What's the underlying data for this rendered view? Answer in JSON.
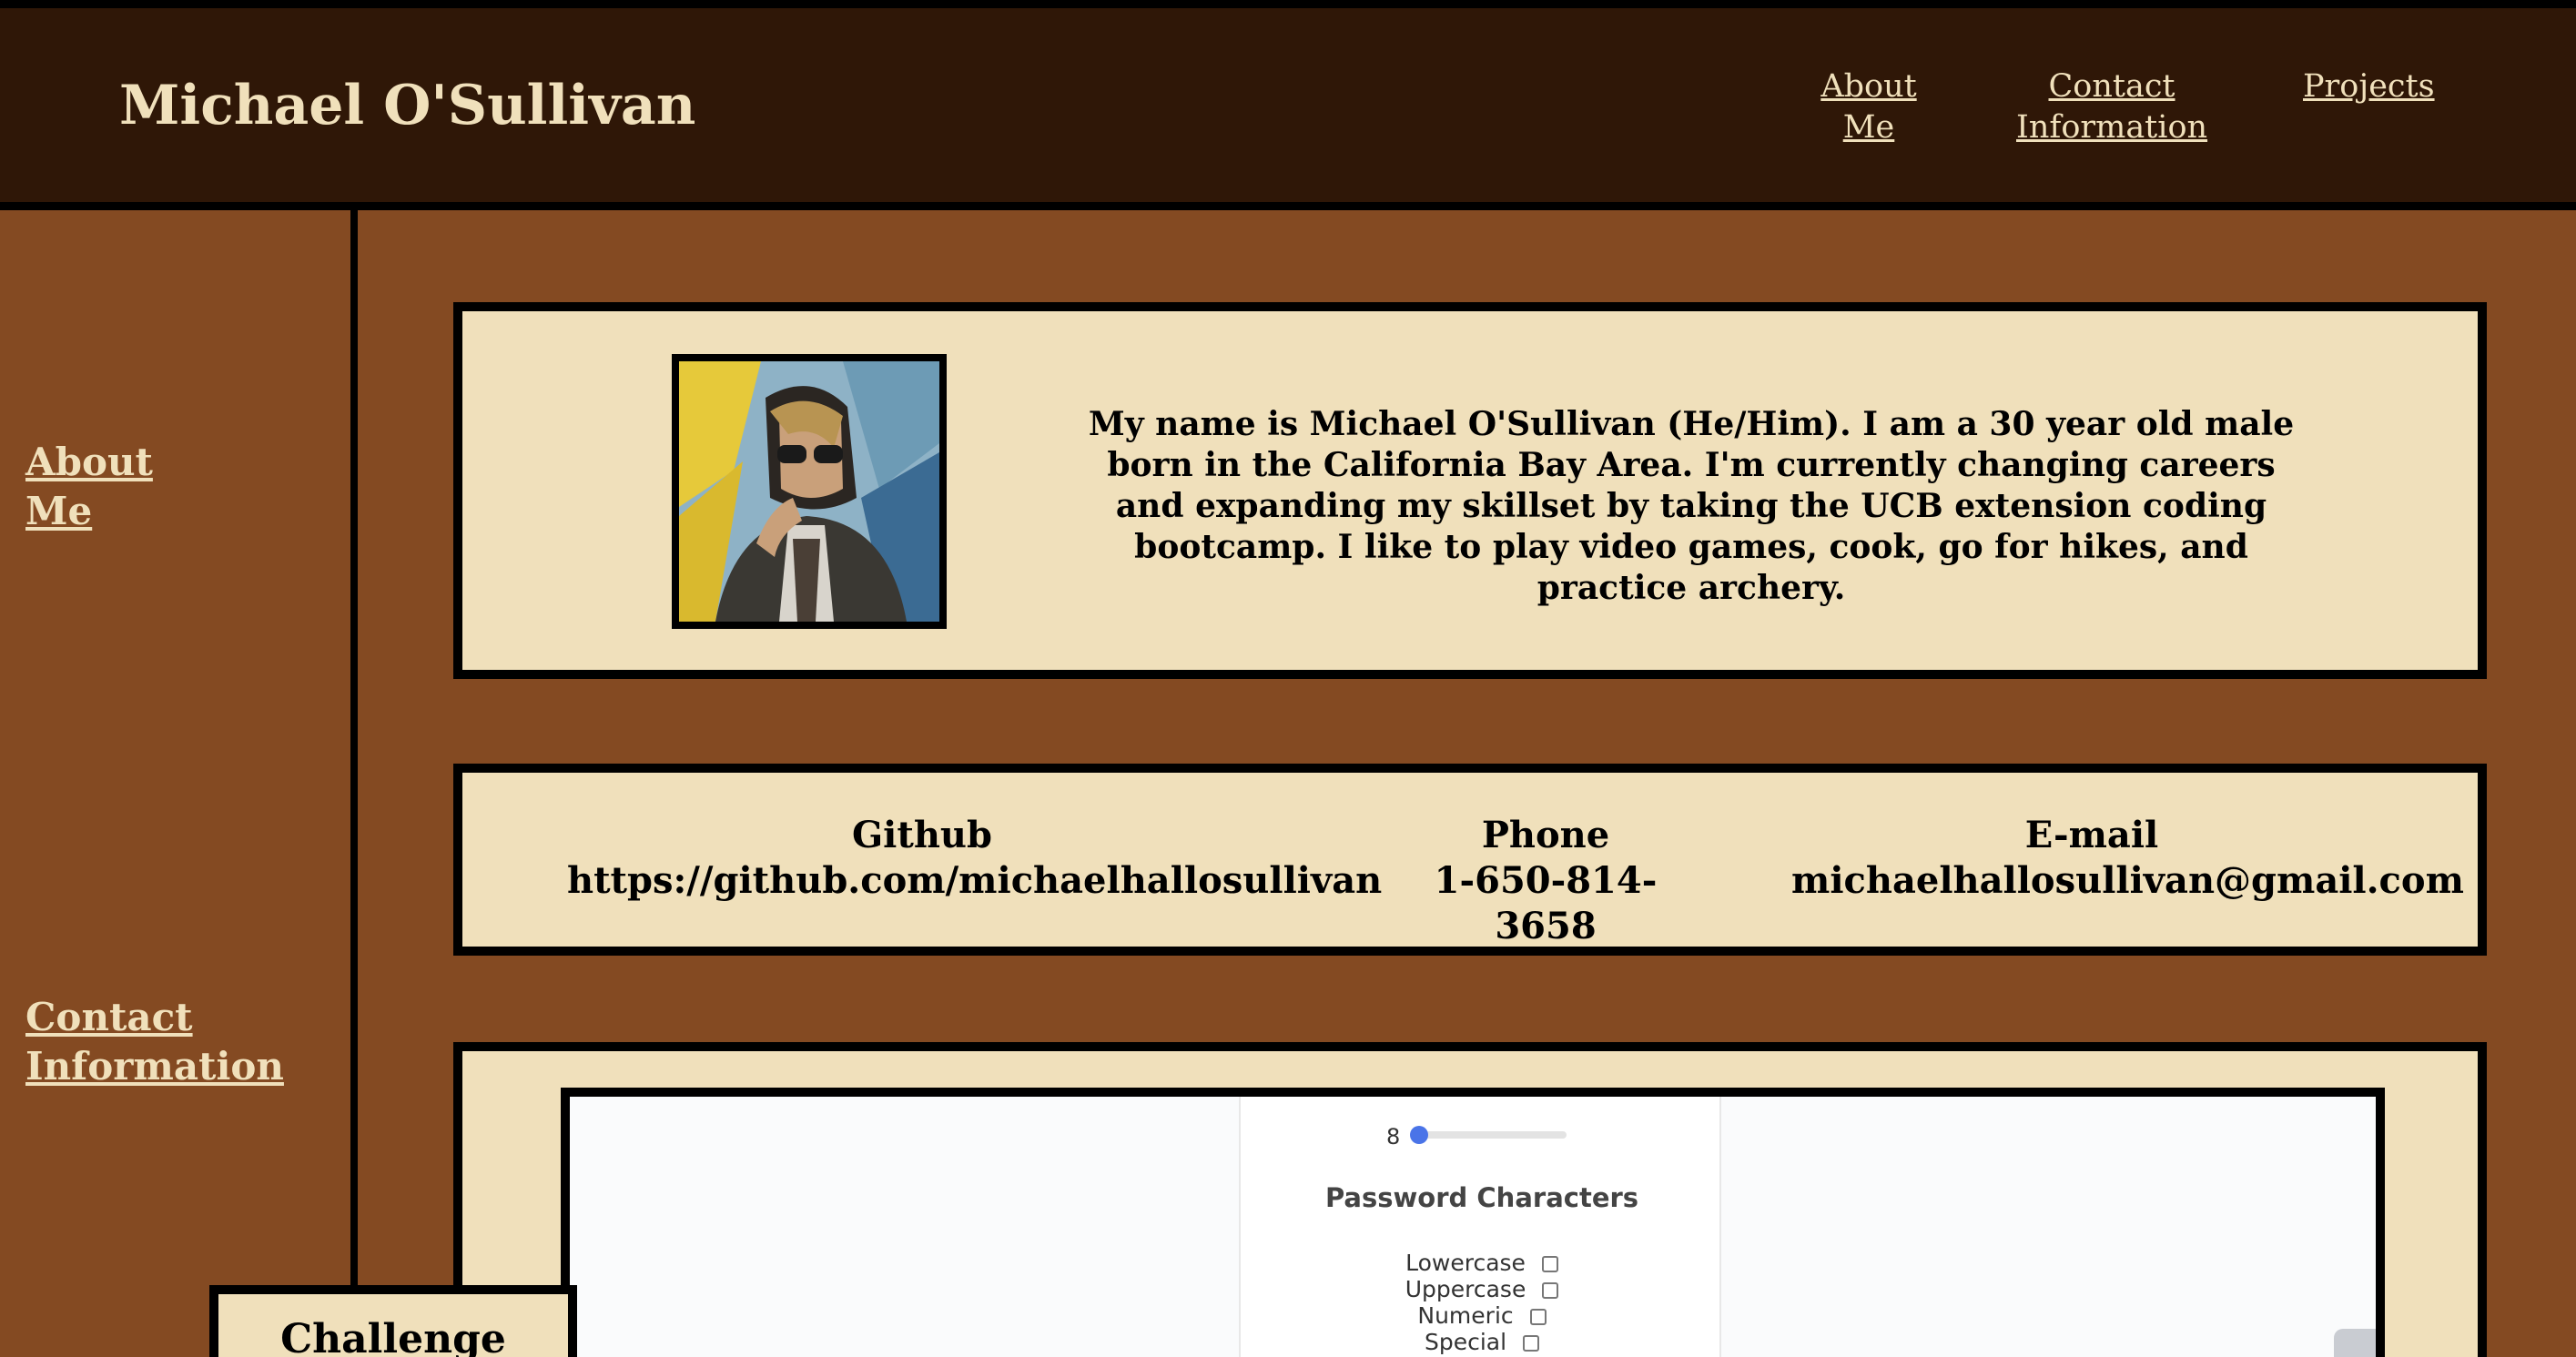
{
  "header": {
    "title": "Michael O'Sullivan",
    "nav": [
      {
        "line1": "About",
        "line2": "Me"
      },
      {
        "line1": "Contact",
        "line2": "Information"
      },
      {
        "line1": "Projects",
        "line2": ""
      }
    ]
  },
  "sidebar": {
    "items": [
      {
        "line1": "About",
        "line2": "Me"
      },
      {
        "line1": "Contact",
        "line2": "Information"
      }
    ]
  },
  "about": {
    "bio": "My name is Michael O'Sullivan (He/Him). I am a 30 year old male born in the California Bay Area. I'm currently changing careers and expanding my skillset by taking the UCB extension coding bootcamp. I like to play video games, cook, go for hikes, and practice archery."
  },
  "contact": {
    "github_label": "Github",
    "github_value": "https://github.com/michaelhallosullivan",
    "phone_label": "Phone",
    "phone_value": "1-650-814-3658",
    "email_label": "E-mail",
    "email_value": "michaelhallosullivan@gmail.com"
  },
  "project": {
    "slider_value": "8",
    "section_title": "Password Characters",
    "options": [
      "Lowercase",
      "Uppercase",
      "Numeric",
      "Special"
    ],
    "badge": "Challenge Three"
  }
}
